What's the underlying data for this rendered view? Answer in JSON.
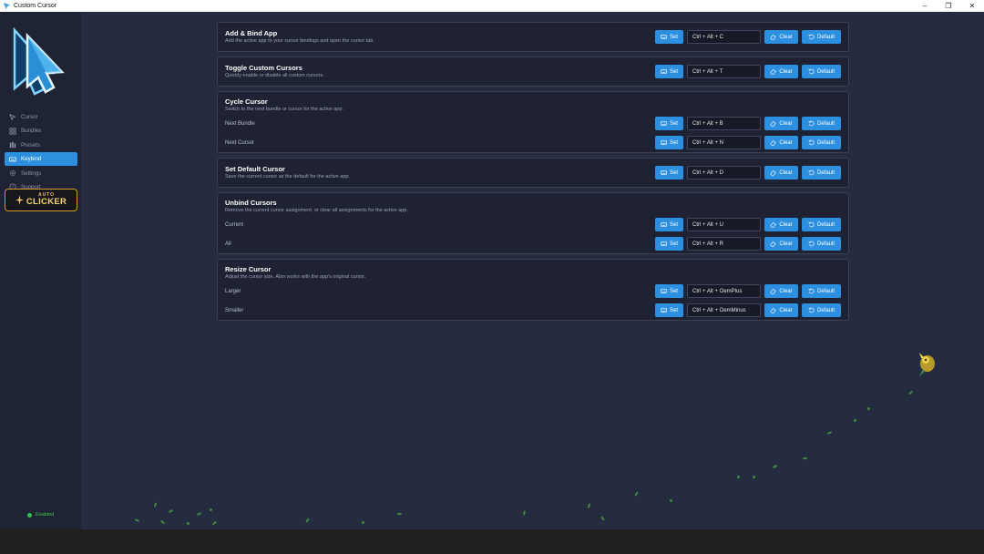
{
  "window": {
    "title": "Custom Cursor"
  },
  "sidebar": {
    "items": [
      {
        "label": "Cursor",
        "icon": "cursor-icon",
        "active": false
      },
      {
        "label": "Bundles",
        "icon": "grid-icon",
        "active": false
      },
      {
        "label": "Presets",
        "icon": "presets-icon",
        "active": false
      },
      {
        "label": "Keybind",
        "icon": "keyboard-icon",
        "active": true
      },
      {
        "label": "Settings",
        "icon": "gear-icon",
        "active": false
      },
      {
        "label": "Support",
        "icon": "help-icon",
        "active": false
      }
    ],
    "promo": {
      "top": "AUTO",
      "bottom": "CLICKER"
    },
    "status": "Enabled"
  },
  "buttons": {
    "set": "Set",
    "clear": "Clear",
    "default": "Default"
  },
  "cards": [
    {
      "title": "Add & Bind App",
      "desc": "Add the active app to your cursor bindings and open the cursor tab.",
      "shortcut": "Ctrl + Alt + C"
    },
    {
      "title": "Toggle Custom Cursors",
      "desc": "Quickly enable or disable all custom cursors.",
      "shortcut": "Ctrl + Alt + T"
    },
    {
      "title": "Cycle Cursor",
      "desc": "Switch to the next bundle or cursor for the active app.",
      "rows": [
        {
          "label": "Next Bundle",
          "shortcut": "Ctrl + Alt + B"
        },
        {
          "label": "Next Cursor",
          "shortcut": "Ctrl + Alt + N"
        }
      ]
    },
    {
      "title": "Set Default Cursor",
      "desc": "Save the current cursor as the default for the active app.",
      "shortcut": "Ctrl + Alt + D"
    },
    {
      "title": "Unbind Cursors",
      "desc": "Remove the current cursor assignment, or clear all assignments for the active app.",
      "rows": [
        {
          "label": "Current",
          "shortcut": "Ctrl + Alt + U"
        },
        {
          "label": "All",
          "shortcut": "Ctrl + Alt + R"
        }
      ]
    },
    {
      "title": "Resize Cursor",
      "desc": "Adjust the cursor size. Also works with the app's original cursor.",
      "rows": [
        {
          "label": "Larger",
          "shortcut": "Ctrl + Alt + OemPlus"
        },
        {
          "label": "Smaller",
          "shortcut": "Ctrl + Alt + OemMinus"
        }
      ]
    }
  ],
  "colors": {
    "accent": "#2c8fe0",
    "background": "#262c40",
    "sidebar": "#1f2435",
    "card": "#1e2232",
    "enabled": "#34c24a",
    "promo_border": "#d8962a"
  }
}
